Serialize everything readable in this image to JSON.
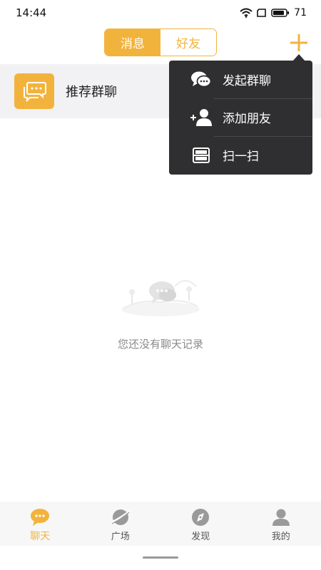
{
  "status_bar": {
    "time": "14:44",
    "battery": "71"
  },
  "header": {
    "tabs": [
      {
        "label": "消息",
        "active": true
      },
      {
        "label": "好友",
        "active": false
      }
    ]
  },
  "recommend": {
    "label": "推荐群聊"
  },
  "popup_menu": {
    "items": [
      {
        "label": "发起群聊",
        "icon": "chat-bubbles-icon"
      },
      {
        "label": "添加朋友",
        "icon": "add-user-icon"
      },
      {
        "label": "扫一扫",
        "icon": "scan-icon"
      }
    ]
  },
  "empty_state": {
    "text": "您还没有聊天记录"
  },
  "bottom_nav": {
    "items": [
      {
        "label": "聊天",
        "icon": "chat-icon",
        "active": true
      },
      {
        "label": "广场",
        "icon": "planet-icon",
        "active": false
      },
      {
        "label": "发现",
        "icon": "compass-icon",
        "active": false
      },
      {
        "label": "我的",
        "icon": "profile-icon",
        "active": false
      }
    ]
  },
  "colors": {
    "accent": "#f2b33d",
    "popup_bg": "#2f2f31",
    "row_bg": "#f2f1f3",
    "nav_inactive": "#9a9a9a"
  }
}
